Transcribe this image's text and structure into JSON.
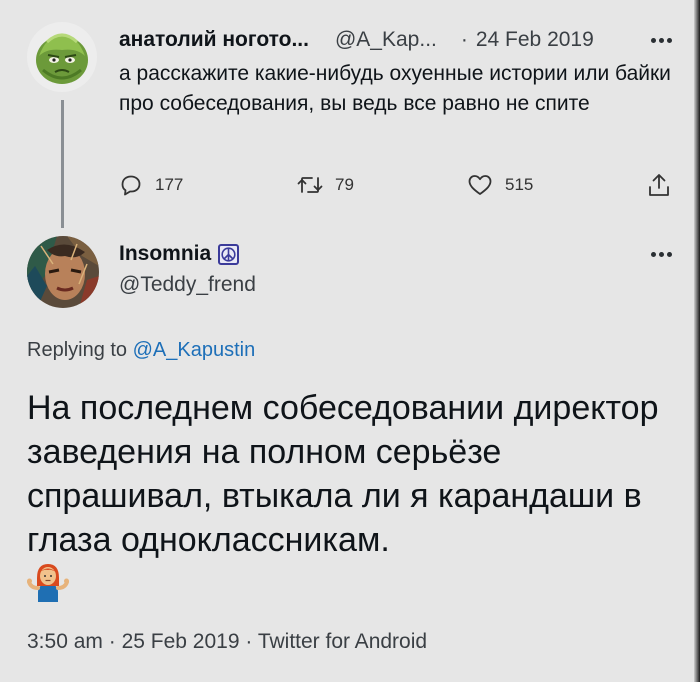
{
  "parent_tweet": {
    "display_name": "анатолий ногото...",
    "handle": "@A_Kap...",
    "separator": "·",
    "date": "24 Feb 2019",
    "text": "а расскажите какие-нибудь охуенные истории или байки про собеседования, вы ведь все равно не спите",
    "counts": {
      "replies": "177",
      "retweets": "79",
      "likes": "515"
    }
  },
  "tweet": {
    "display_name": "Insomnia",
    "handle": "@Teddy_frend",
    "replying_prefix": "Replying to",
    "replying_to": "@A_Kapustin",
    "text": "На последнем собеседовании директор заведения на полном серьёзе спрашивал, втыкала ли я карандаши в глаза одноклассникам.",
    "time": "3:50 am",
    "date": "25 Feb 2019",
    "source": "Twitter for Android",
    "meta_separator": "·"
  },
  "colors": {
    "background": "#e6e6e6",
    "text": "#0f1419",
    "secondary": "#3a3f44",
    "mention": "#1d6fb8",
    "thread_line": "#8a8f94"
  },
  "icons": {
    "reply": "reply-icon",
    "retweet": "retweet-icon",
    "like": "heart-icon",
    "share": "share-icon",
    "more": "more-dots-icon",
    "badge": "peace-sign-icon",
    "emoji": "person-shrugging-emoji"
  }
}
